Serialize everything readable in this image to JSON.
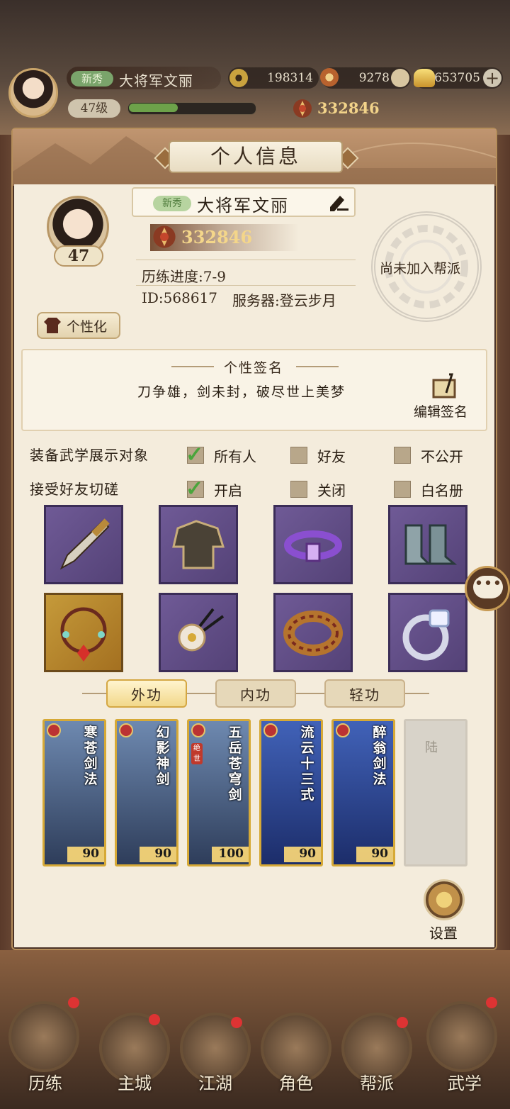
{
  "hud": {
    "badge": "新秀",
    "name": "大将军文丽",
    "level": "47级",
    "xp_fraction": 0.39,
    "coins": "198314",
    "stamina": "9278",
    "gold": "653705",
    "power": "332846"
  },
  "panel": {
    "title": "个人信息"
  },
  "profile": {
    "level": "47",
    "badge": "新秀",
    "name": "大将军文丽",
    "power": "332846",
    "progress": "历练进度:7-9",
    "id": "ID:568617",
    "server": "服务器:登云步月",
    "guild": "尚未加入帮派",
    "customize": "个性化"
  },
  "signature": {
    "title": "个性签名",
    "text": "刀争雄，剑未封，破尽世上美梦",
    "edit_label": "编辑签名"
  },
  "options": {
    "equip_display": {
      "label": "装备武学展示对象",
      "choices": [
        {
          "label": "所有人",
          "checked": true
        },
        {
          "label": "好友",
          "checked": false
        },
        {
          "label": "不公开",
          "checked": false
        }
      ]
    },
    "friend_duel": {
      "label": "接受好友切磋",
      "choices": [
        {
          "label": "开启",
          "checked": true
        },
        {
          "label": "关闭",
          "checked": false
        },
        {
          "label": "白名册",
          "checked": false
        }
      ]
    }
  },
  "equipment": [
    "dagger-icon",
    "robe-icon",
    "belt-icon",
    "boots-icon",
    "bracelet-icon",
    "hairpin-icon",
    "ring-icon",
    "jade-ring-icon"
  ],
  "skill_tabs": [
    "外功",
    "内功",
    "轻功"
  ],
  "skills": [
    {
      "name": "寒苍剑法",
      "level": "90"
    },
    {
      "name": "幻影神剑",
      "level": "90"
    },
    {
      "name": "五岳苍穹剑",
      "level": "100",
      "tag": "绝世"
    },
    {
      "name": "流云十三式",
      "level": "90"
    },
    {
      "name": "醉翁剑法",
      "level": "90"
    }
  ],
  "empty_slot": "陆",
  "settings_label": "设置",
  "nav": [
    "历练",
    "主城",
    "江湖",
    "角色",
    "帮派",
    "武学"
  ],
  "colors": {
    "accent_gold": "#d6a936",
    "panel_bg": "#f4ecdc",
    "check_green": "#4aa53c"
  }
}
